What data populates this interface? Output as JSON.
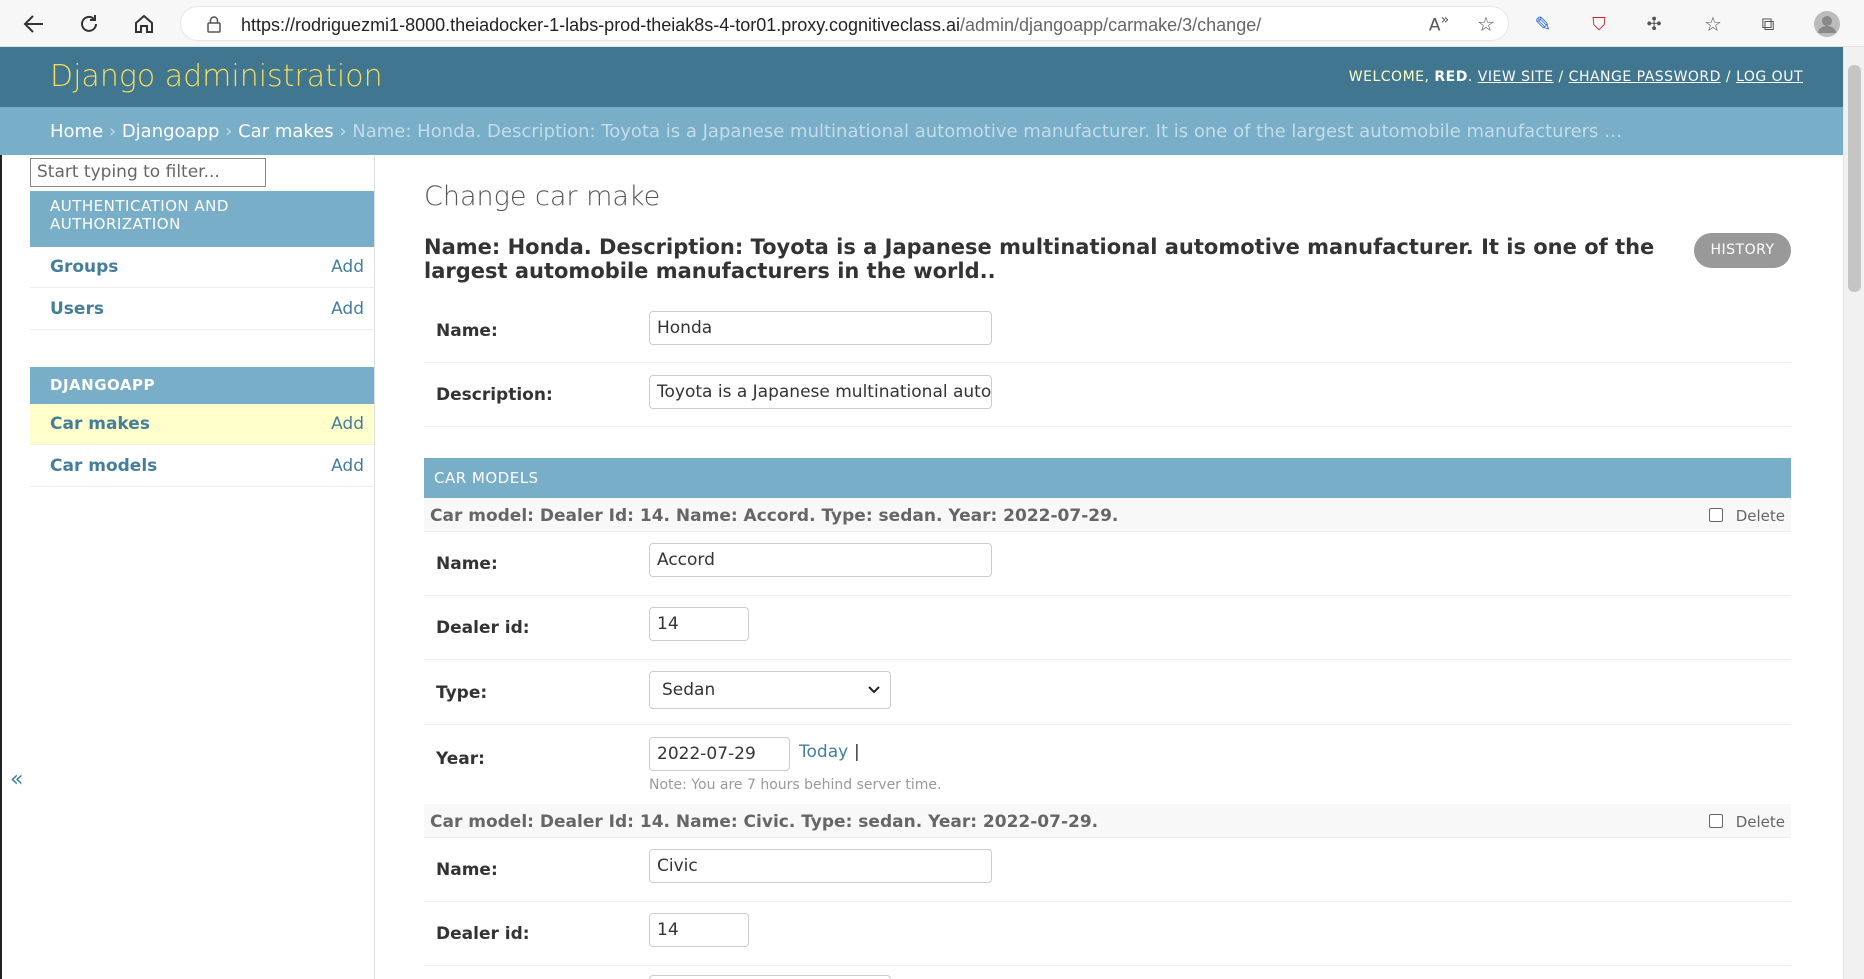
{
  "browser": {
    "url_main": "https://rodriguezmi1-8000.theiadocker-1-labs-prod-theiak8s-4-tor01.proxy.cognitiveclass.ai",
    "url_path": "/admin/djangoapp/carmake/3/change/"
  },
  "header": {
    "brand": "Django administration",
    "welcome": "WELCOME,",
    "username": "RED",
    "view_site": "VIEW SITE",
    "change_password": "CHANGE PASSWORD",
    "log_out": "LOG OUT"
  },
  "breadcrumbs": {
    "home": "Home",
    "app": "Djangoapp",
    "model": "Car makes",
    "current": "Name: Honda. Description: Toyota is a Japanese multinational automotive manufacturer. It is one of the largest automobile manufacturers …"
  },
  "sidebar": {
    "filter_placeholder": "Start typing to filter...",
    "toggle": "«",
    "auth_caption": "AUTHENTICATION AND AUTHORIZATION",
    "auth_items": [
      {
        "label": "Groups",
        "add": "Add"
      },
      {
        "label": "Users",
        "add": "Add"
      }
    ],
    "app_caption": "DJANGOAPP",
    "app_items": [
      {
        "label": "Car makes",
        "add": "Add"
      },
      {
        "label": "Car models",
        "add": "Add"
      }
    ]
  },
  "main": {
    "title": "Change car make",
    "object_title": "Name: Honda. Description: Toyota is a Japanese multinational automotive manufacturer. It is one of the largest automobile manufacturers in the world..",
    "history": "HISTORY",
    "name_label": "Name:",
    "name_value": "Honda",
    "description_label": "Description:",
    "description_value": "Toyota is a Japanese multinational automotive manufacturer"
  },
  "inlines": {
    "caption": "CAR MODELS",
    "delete_label": "Delete",
    "name_label": "Name:",
    "dealer_label": "Dealer id:",
    "type_label": "Type:",
    "year_label": "Year:",
    "today": "Today",
    "separator": "|",
    "time_note": "Note: You are 7 hours behind server time.",
    "items": [
      {
        "title": "Car model: Dealer Id: 14. Name: Accord. Type: sedan. Year: 2022-07-29.",
        "name": "Accord",
        "dealer_id": "14",
        "type": "Sedan",
        "year": "2022-07-29"
      },
      {
        "title": "Car model: Dealer Id: 14. Name: Civic. Type: sedan. Year: 2022-07-29.",
        "name": "Civic",
        "dealer_id": "14"
      }
    ]
  }
}
